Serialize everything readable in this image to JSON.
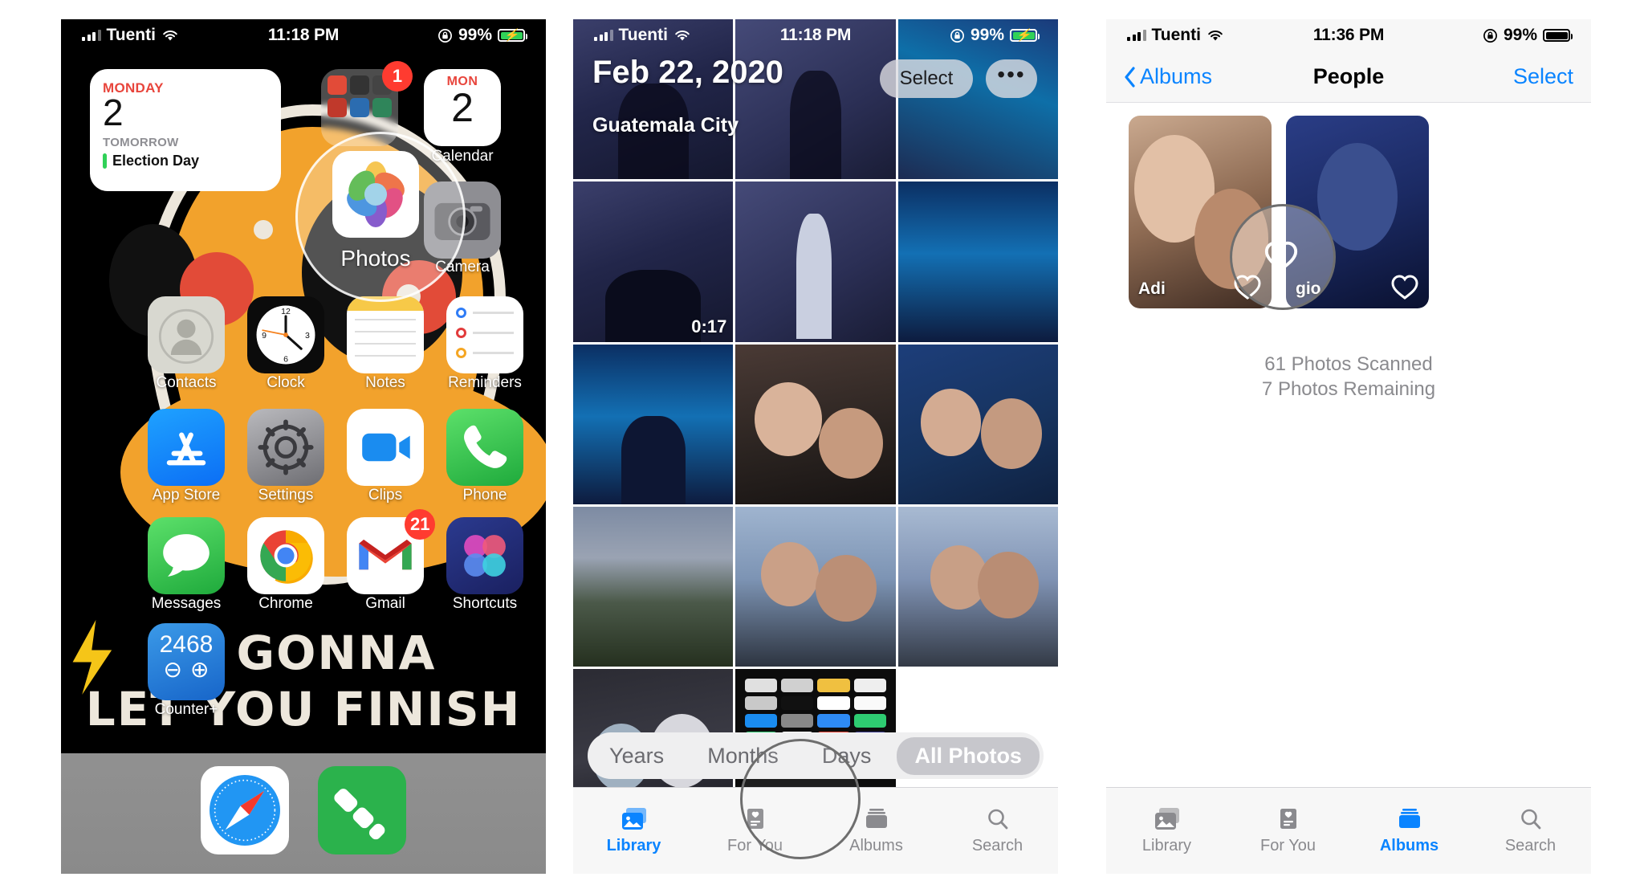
{
  "phone1": {
    "status": {
      "carrier": "Tuenti",
      "time": "11:18 PM",
      "battery": "99%",
      "wifi_icon": "wifi-icon",
      "signal_icon": "signal-bars-icon",
      "battery_icon": "battery-charging-icon",
      "lock_icon": "rotation-lock-icon"
    },
    "calendar_widget": {
      "dow": "MONDAY",
      "day": "2",
      "when": "TOMORROW",
      "event": "Election Day"
    },
    "mini_calendar": {
      "dow": "MON",
      "day": "2"
    },
    "badges": {
      "folder": "1",
      "gmail": "21"
    },
    "apps": [
      {
        "name": "Calendar",
        "label": "Calendar"
      },
      {
        "name": "Photos",
        "label": "Photos"
      },
      {
        "name": "Camera",
        "label": "Camera"
      },
      {
        "name": "Contacts",
        "label": "Contacts"
      },
      {
        "name": "Clock",
        "label": "Clock"
      },
      {
        "name": "Notes",
        "label": "Notes"
      },
      {
        "name": "Reminders",
        "label": "Reminders"
      },
      {
        "name": "App Store",
        "label": "App Store"
      },
      {
        "name": "Settings",
        "label": "Settings"
      },
      {
        "name": "Clips",
        "label": "Clips"
      },
      {
        "name": "Phone",
        "label": "Phone"
      },
      {
        "name": "Messages",
        "label": "Messages"
      },
      {
        "name": "Chrome",
        "label": "Chrome"
      },
      {
        "name": "Gmail",
        "label": "Gmail"
      },
      {
        "name": "Shortcuts",
        "label": "Shortcuts"
      },
      {
        "name": "Counter+",
        "label": "Counter+"
      }
    ],
    "counter_widget": {
      "value": "2468",
      "minus": "⊖",
      "plus": "⊕"
    },
    "dock": [
      {
        "name": "Safari"
      },
      {
        "name": "Feedly"
      }
    ],
    "wallpaper_text_line1": "M GONNA",
    "wallpaper_text_line2": "LET YOU FINISH"
  },
  "phone2": {
    "status": {
      "carrier": "Tuenti",
      "time": "11:18 PM",
      "battery": "99%"
    },
    "date_header": "Feb 22, 2020",
    "location": "Guatemala City",
    "select_label": "Select",
    "more_label": "•••",
    "video_duration": "0:17",
    "segments": [
      {
        "label": "Years",
        "active": false
      },
      {
        "label": "Months",
        "active": false
      },
      {
        "label": "Days",
        "active": false
      },
      {
        "label": "All Photos",
        "active": true
      }
    ],
    "tabs": [
      {
        "label": "Library",
        "icon": "photos-library-icon",
        "active": true
      },
      {
        "label": "For You",
        "icon": "for-you-icon",
        "active": false
      },
      {
        "label": "Albums",
        "icon": "albums-icon",
        "active": false
      },
      {
        "label": "Search",
        "icon": "search-icon",
        "active": false
      }
    ],
    "highlight": "albums-tab-highlight"
  },
  "phone3": {
    "status": {
      "carrier": "Tuenti",
      "time": "11:36 PM",
      "battery": "99%"
    },
    "nav": {
      "back": "Albums",
      "title": "People",
      "select": "Select"
    },
    "people": [
      {
        "name": "Adi",
        "favorite_icon": "heart-outline-icon"
      },
      {
        "name": "gio",
        "favorite_icon": "heart-outline-icon"
      }
    ],
    "scan_status_line1": "61 Photos Scanned",
    "scan_status_line2": "7 Photos Remaining",
    "tabs": [
      {
        "label": "Library",
        "icon": "photos-library-icon",
        "active": false
      },
      {
        "label": "For You",
        "icon": "for-you-icon",
        "active": false
      },
      {
        "label": "Albums",
        "icon": "albums-icon",
        "active": true
      },
      {
        "label": "Search",
        "icon": "search-icon",
        "active": false
      }
    ]
  },
  "colors": {
    "accent": "#0A84FF",
    "badge_red": "#FF3B30",
    "green": "#30D158",
    "cal_red": "#E8453C"
  }
}
